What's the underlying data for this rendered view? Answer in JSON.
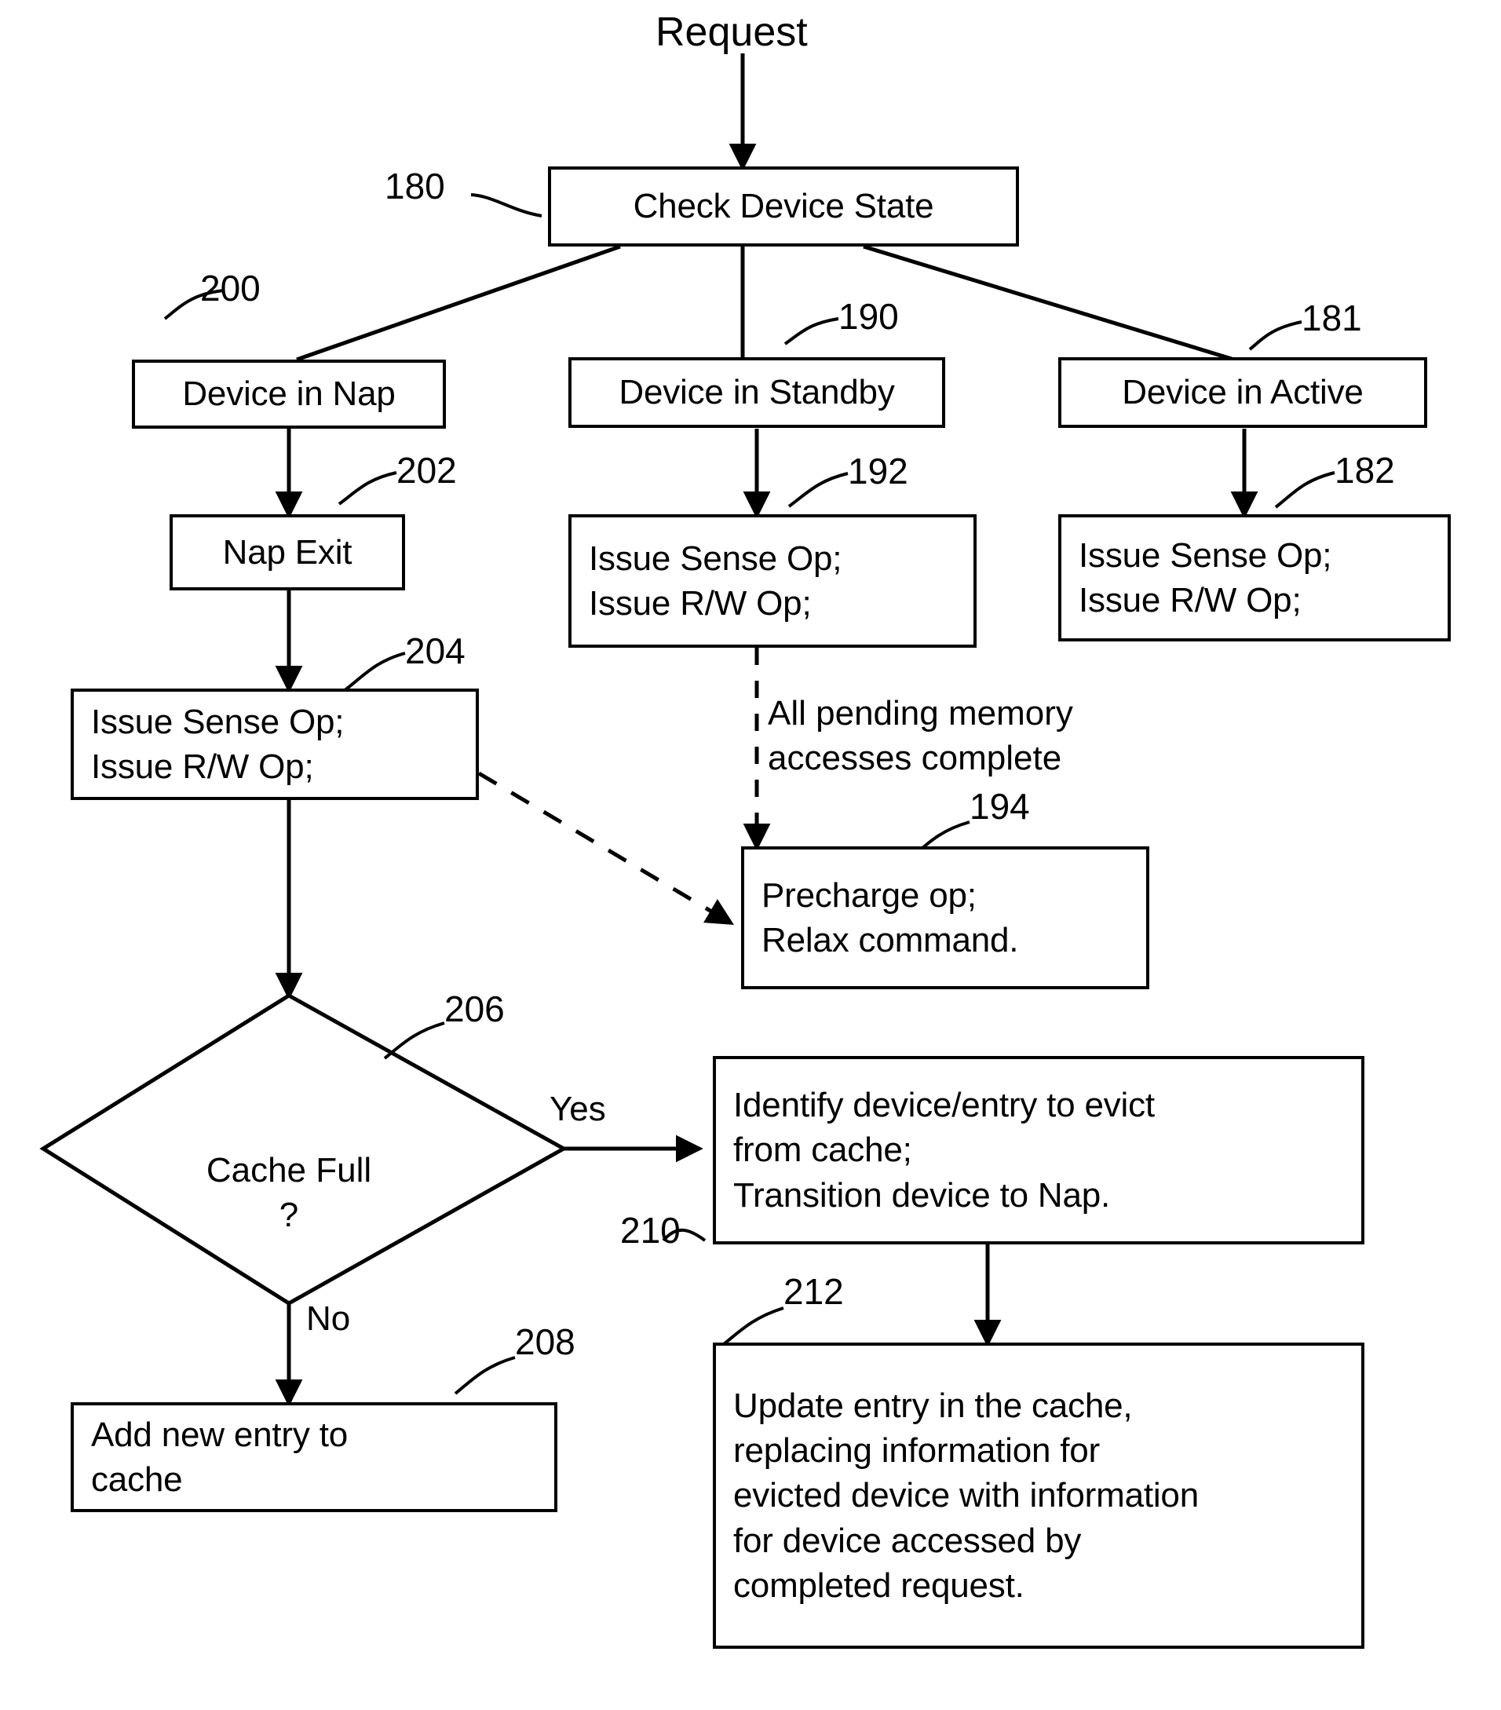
{
  "figure": {
    "type": "patent-flowchart",
    "entry_label": "Request"
  },
  "nodes": {
    "check_device_state": {
      "ref": "180",
      "text": "Check Device State"
    },
    "device_in_nap": {
      "ref": "200",
      "text": "Device in Nap"
    },
    "device_in_standby": {
      "ref": "190",
      "text": "Device in Standby"
    },
    "device_in_active": {
      "ref": "181",
      "text": "Device in Active"
    },
    "nap_exit": {
      "ref": "202",
      "text": "Nap Exit"
    },
    "issue_ops_nap": {
      "ref": "204",
      "text": "Issue Sense Op;\nIssue R/W Op;"
    },
    "issue_ops_standby": {
      "ref": "192",
      "text": "Issue Sense Op;\nIssue R/W Op;"
    },
    "issue_ops_active": {
      "ref": "182",
      "text": "Issue Sense Op;\nIssue R/W Op;"
    },
    "precharge": {
      "ref": "194",
      "text": "Precharge op;\nRelax command."
    },
    "cache_full": {
      "ref": "206",
      "text": "Cache Full\n?"
    },
    "add_new_entry": {
      "ref": "208",
      "text": "Add new entry to\ncache"
    },
    "identify_evict": {
      "ref": "210",
      "text": "Identify device/entry to evict\nfrom cache;\nTransition device to Nap."
    },
    "update_entry": {
      "ref": "212",
      "text": "Update entry in the cache,\nreplacing information for\nevicted device with information\nfor device accessed by\ncompleted request."
    }
  },
  "edge_labels": {
    "pending_accesses": "All pending memory\naccesses complete",
    "yes": "Yes",
    "no": "No"
  },
  "colors": {
    "stroke": "#000000",
    "background": "#ffffff"
  }
}
